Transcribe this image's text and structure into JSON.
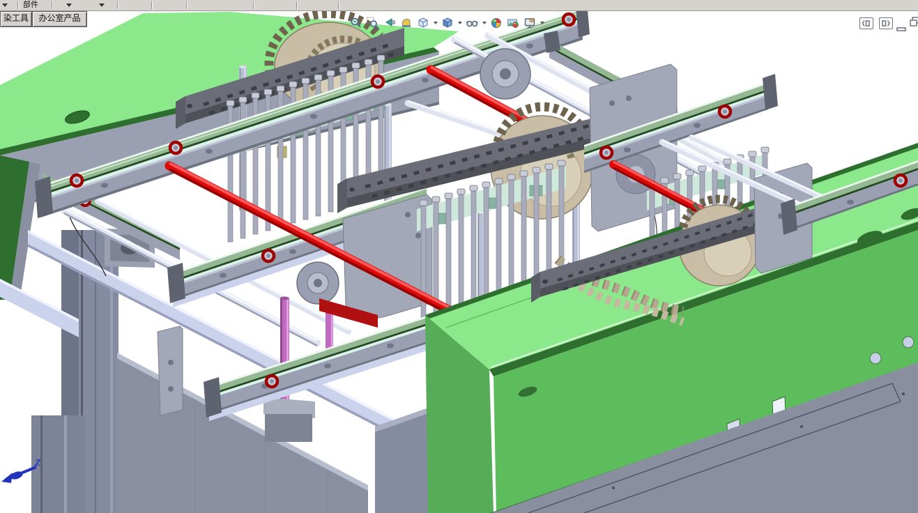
{
  "toolbar": {
    "component_label": "部件",
    "dropdown_icon": "menu-dropdown-caret"
  },
  "tabs": {
    "items": [
      {
        "label": "染工具"
      },
      {
        "label": "办公室产品"
      }
    ]
  },
  "heads_up": {
    "buttons": [
      {
        "name": "zoom-to-fit"
      },
      {
        "name": "zoom-to-area"
      },
      {
        "name": "previous-view"
      },
      {
        "name": "section-view"
      },
      {
        "name": "view-orientation"
      },
      {
        "name": "display-style"
      },
      {
        "name": "hide-show-items"
      },
      {
        "name": "edit-appearance"
      },
      {
        "name": "apply-scene"
      },
      {
        "name": "view-settings"
      }
    ]
  },
  "window_controls": [
    {
      "name": "display-pane-left"
    },
    {
      "name": "display-pane-right"
    },
    {
      "name": "minimize-document"
    },
    {
      "name": "restore-document"
    }
  ],
  "triad": {
    "axis_label": "Z"
  },
  "model_parts": [
    {
      "name": "machine-table",
      "color": "#8BE88B"
    },
    {
      "name": "safety-cover",
      "color": "#5DBD5D"
    },
    {
      "name": "linear-guide-rails",
      "color": "#93B893"
    },
    {
      "name": "gripper-comb-banks",
      "color": "#A8ACBC"
    },
    {
      "name": "timing-gears",
      "color": "#C9BEA5"
    },
    {
      "name": "red-drive-shafts",
      "color": "#DE0A0A"
    },
    {
      "name": "bearing-rings",
      "color": "#9E0000"
    },
    {
      "name": "cable-chain-bars",
      "color": "#6B6E78"
    },
    {
      "name": "aluminum-frame",
      "color": "#CBD2EC"
    },
    {
      "name": "magenta-rods",
      "color": "#C06AC0"
    }
  ],
  "colors": {
    "background": "#FFFFFF",
    "toolbar_bg": "#D6D3CE",
    "machine_green": "#8BE88B",
    "cover_front_green": "#5DBD5D",
    "green_dark": "#2E6E2E",
    "rail_green": "#93B893",
    "part_gray": "#9AA0B2",
    "aluminum": "#CBD2EC",
    "accent_red": "#DE0A0A",
    "bearing_ring_red": "#9E0000",
    "gear_tan": "#C9BEA5",
    "magenta_rod": "#C06AC0",
    "cyan_backing": "#D9F2EC",
    "comb_backing": "#CFE8DC",
    "yellow_block": "#BDB76B",
    "triad_blue": "#2233BB"
  }
}
